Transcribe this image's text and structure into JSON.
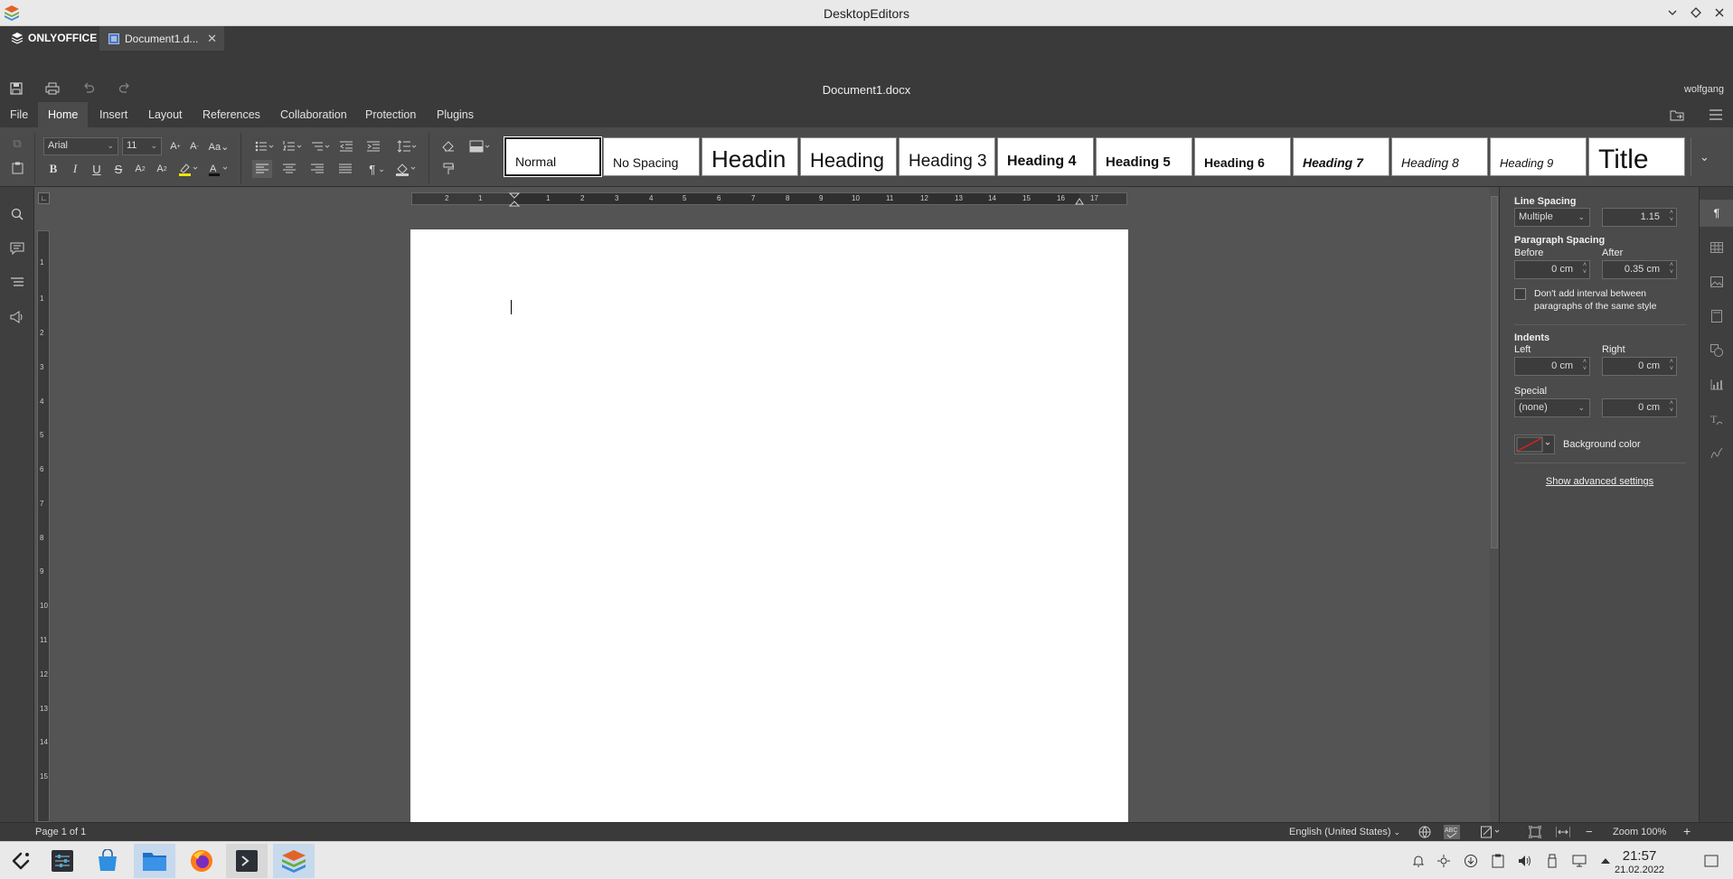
{
  "window": {
    "title": "DesktopEditors"
  },
  "app": {
    "brand": "ONLYOFFICE",
    "tab_label": "Document1.d...",
    "doc_title": "Document1.docx",
    "user": "wolfgang"
  },
  "menu": {
    "tabs": [
      {
        "label": "File"
      },
      {
        "label": "Home"
      },
      {
        "label": "Insert"
      },
      {
        "label": "Layout"
      },
      {
        "label": "References"
      },
      {
        "label": "Collaboration"
      },
      {
        "label": "Protection"
      },
      {
        "label": "Plugins"
      }
    ],
    "active": "Home"
  },
  "ribbon": {
    "font_name": "Arial",
    "font_size": "11",
    "styles": [
      {
        "label": "Normal"
      },
      {
        "label": "No Spacing"
      },
      {
        "label": "Headin"
      },
      {
        "label": "Heading"
      },
      {
        "label": "Heading 3"
      },
      {
        "label": "Heading 4"
      },
      {
        "label": "Heading 5"
      },
      {
        "label": "Heading 6"
      },
      {
        "label": "Heading 7"
      },
      {
        "label": "Heading 8"
      },
      {
        "label": "Heading 9"
      },
      {
        "label": "Title"
      }
    ],
    "selected_style": "Normal"
  },
  "ruler": {
    "h_labels": [
      "2",
      "1",
      "1",
      "2",
      "3",
      "4",
      "5",
      "6",
      "7",
      "8",
      "9",
      "10",
      "11",
      "12",
      "13",
      "14",
      "15",
      "16",
      "17"
    ],
    "v_labels": [
      "1",
      "1",
      "2",
      "3",
      "4",
      "5",
      "6",
      "7",
      "8",
      "9",
      "10",
      "11",
      "12",
      "13",
      "14",
      "15"
    ]
  },
  "paragraph": {
    "line_spacing_title": "Line Spacing",
    "line_spacing_mode": "Multiple",
    "line_spacing_value": "1.15",
    "paragraph_spacing_title": "Paragraph Spacing",
    "before_label": "Before",
    "before_value": "0 cm",
    "after_label": "After",
    "after_value": "0.35 cm",
    "no_interval_label_1": "Don't add interval between",
    "no_interval_label_2": "paragraphs of the same style",
    "no_interval_checked": false,
    "indents_title": "Indents",
    "left_label": "Left",
    "left_value": "0 cm",
    "right_label": "Right",
    "right_value": "0 cm",
    "special_label": "Special",
    "special_value": "(none)",
    "special_amount": "0 cm",
    "background_color_label": "Background color",
    "advanced_link": "Show advanced settings"
  },
  "status": {
    "page": "Page 1 of 1",
    "language": "English (United States)",
    "zoom": "Zoom 100%"
  },
  "taskbar": {
    "time": "21:57",
    "date": "21.02.2022"
  },
  "colors": {
    "toolbar_bg": "#3a3a3a",
    "ribbon_bg": "#4b4b4b",
    "work_bg": "#545454",
    "page_bg": "#ffffff",
    "taskbar_bg": "#e9e9e9",
    "accent_onlyoffice": "#ff6f3d"
  }
}
